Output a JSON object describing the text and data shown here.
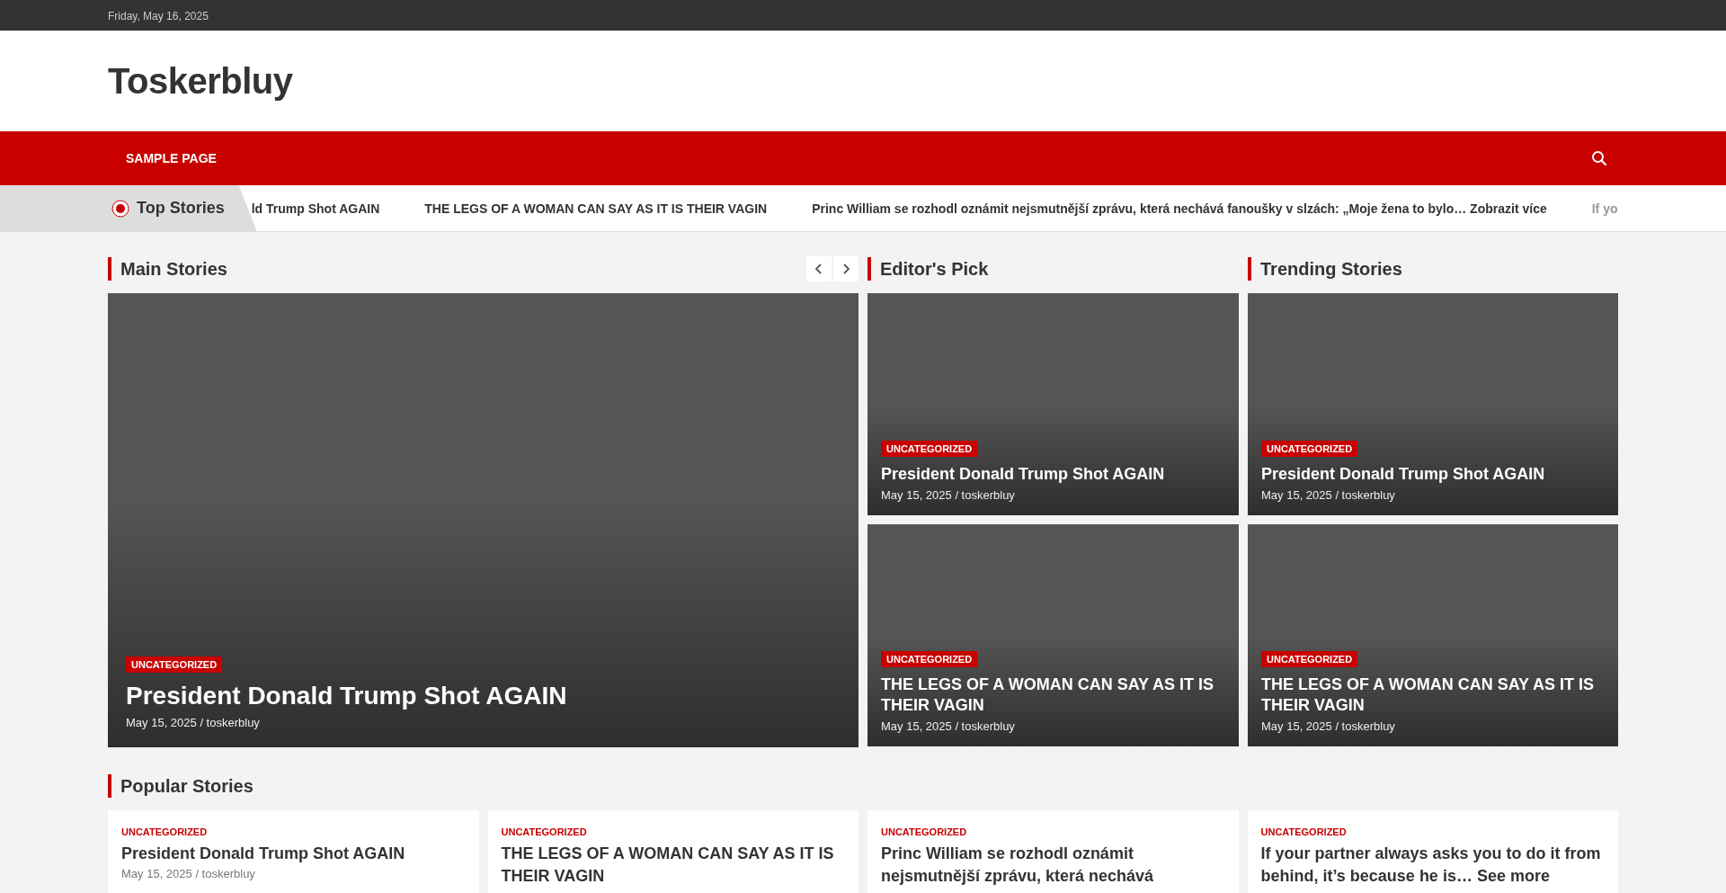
{
  "top_bar": {
    "date": "Friday, May 16, 2025"
  },
  "header": {
    "site_title": "Toskerbluy"
  },
  "nav": {
    "items": [
      {
        "label": "SAMPLE PAGE"
      }
    ]
  },
  "ticker": {
    "label": "Top Stories",
    "items": [
      {
        "text": "ld Trump Shot AGAIN",
        "faded": false
      },
      {
        "text": "THE LEGS OF A WOMAN CAN SAY AS IT IS THEIR VAGIN",
        "faded": false
      },
      {
        "text": "Princ William se rozhodl oznámit nejsmutnější zprávu, která nechává fanoušky v slzách: „Moje žena to bylo… Zobrazit více",
        "faded": false
      },
      {
        "text": "If yo",
        "faded": true
      }
    ]
  },
  "main_stories": {
    "title": "Main Stories",
    "story": {
      "category": "UNCATEGORIZED",
      "title": "President Donald Trump Shot AGAIN",
      "meta": "May 15, 2025 / toskerbluy"
    }
  },
  "editors_pick": {
    "title": "Editor's Pick",
    "stories": [
      {
        "category": "UNCATEGORIZED",
        "title": "President Donald Trump Shot AGAIN",
        "meta": "May 15, 2025 / toskerbluy"
      },
      {
        "category": "UNCATEGORIZED",
        "title": "THE LEGS OF A WOMAN CAN SAY AS IT IS THEIR VAGIN",
        "meta": "May 15, 2025 / toskerbluy"
      }
    ]
  },
  "trending": {
    "title": "Trending Stories",
    "stories": [
      {
        "category": "UNCATEGORIZED",
        "title": "President Donald Trump Shot AGAIN",
        "meta": "May 15, 2025 / toskerbluy"
      },
      {
        "category": "UNCATEGORIZED",
        "title": "THE LEGS OF A WOMAN CAN SAY AS IT IS THEIR VAGIN",
        "meta": "May 15, 2025 / toskerbluy"
      }
    ]
  },
  "popular": {
    "title": "Popular Stories",
    "stories": [
      {
        "category": "UNCATEGORIZED",
        "title": "President Donald Trump Shot AGAIN",
        "meta": "May 15, 2025 / toskerbluy"
      },
      {
        "category": "UNCATEGORIZED",
        "title": "THE LEGS OF A WOMAN CAN SAY AS IT IS THEIR VAGIN"
      },
      {
        "category": "UNCATEGORIZED",
        "title": "Princ William se rozhodl oznámit nejsmutnější zprávu, která nechává"
      },
      {
        "category": "UNCATEGORIZED",
        "title": "If your partner always asks you to do it from behind, it’s because he is… See more"
      }
    ]
  }
}
